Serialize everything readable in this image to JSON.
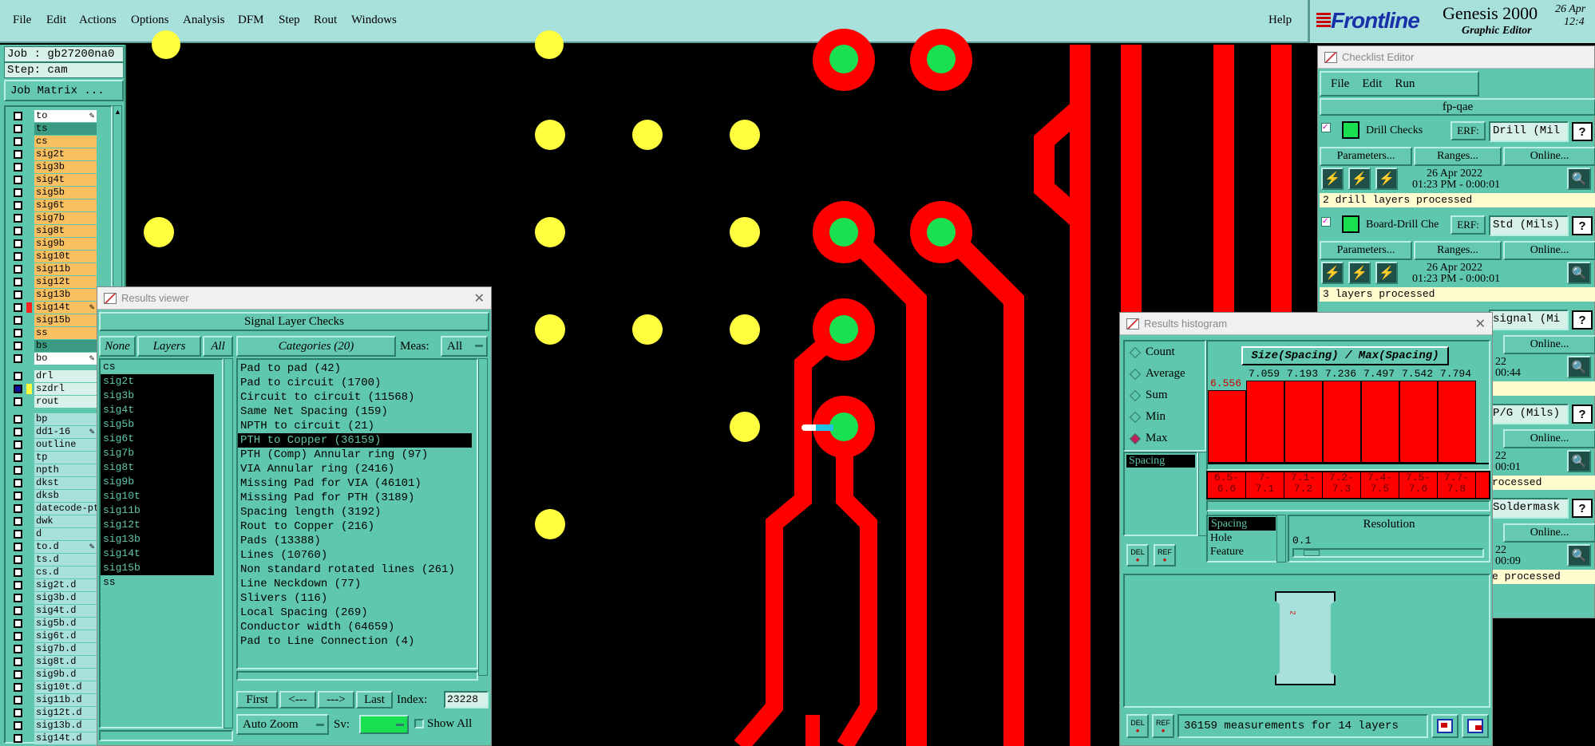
{
  "menubar": {
    "items": [
      "File",
      "Edit",
      "Actions",
      "Options",
      "Analysis",
      "DFM",
      "Step",
      "Rout",
      "Windows"
    ],
    "help": "Help"
  },
  "logo": {
    "brand": "Frontline",
    "product": "Genesis 2000",
    "subtitle": "Graphic Editor",
    "date": "26 Apr",
    "time": "12:4"
  },
  "job": {
    "job_label": "Job : gb27200na0",
    "step_label": "Step: cam",
    "matrix_button": "Job Matrix ..."
  },
  "layers": [
    {
      "name": "to",
      "bg": "#ffffff",
      "mark": true
    },
    {
      "name": "ts",
      "bg": "#3a9b82"
    },
    {
      "name": "cs",
      "bg": "#f8c060"
    },
    {
      "name": "sig2t",
      "bg": "#f8c060"
    },
    {
      "name": "sig3b",
      "bg": "#f8c060"
    },
    {
      "name": "sig4t",
      "bg": "#f8c060"
    },
    {
      "name": "sig5b",
      "bg": "#f8c060"
    },
    {
      "name": "sig6t",
      "bg": "#f8c060"
    },
    {
      "name": "sig7b",
      "bg": "#f8c060"
    },
    {
      "name": "sig8t",
      "bg": "#f8c060"
    },
    {
      "name": "sig9b",
      "bg": "#f8c060"
    },
    {
      "name": "sig10t",
      "bg": "#f8c060"
    },
    {
      "name": "sig11b",
      "bg": "#f8c060"
    },
    {
      "name": "sig12t",
      "bg": "#f8c060"
    },
    {
      "name": "sig13b",
      "bg": "#f8c060"
    },
    {
      "name": "sig14t",
      "bg": "#f8c060",
      "swatch": "#ff2020",
      "mark": true
    },
    {
      "name": "sig15b",
      "bg": "#f8c060"
    },
    {
      "name": "ss",
      "bg": "#f8c060"
    },
    {
      "name": "bs",
      "bg": "#3a9b82"
    },
    {
      "name": "bo",
      "bg": "#ffffff",
      "mark": true
    },
    {
      "name": "drl",
      "bg": "#d8f0ea",
      "gap": true
    },
    {
      "name": "szdrl",
      "bg": "#d8f0ea",
      "swatch": "#ffff40",
      "cbfill": "#1010a0"
    },
    {
      "name": "rout",
      "bg": "#d8f0ea"
    },
    {
      "name": "bp",
      "bg": "#a8e0dc",
      "gap": true
    },
    {
      "name": "dd1-16",
      "bg": "#a8e0dc",
      "mark": true
    },
    {
      "name": "outline",
      "bg": "#a8e0dc"
    },
    {
      "name": "tp",
      "bg": "#a8e0dc"
    },
    {
      "name": "npth",
      "bg": "#a8e0dc"
    },
    {
      "name": "dkst",
      "bg": "#a8e0dc"
    },
    {
      "name": "dksb",
      "bg": "#a8e0dc"
    },
    {
      "name": "datecode-pt",
      "bg": "#a8e0dc"
    },
    {
      "name": "dwk",
      "bg": "#a8e0dc"
    },
    {
      "name": "d",
      "bg": "#a8e0dc"
    },
    {
      "name": "to.d",
      "bg": "#a8e0dc",
      "mark": true
    },
    {
      "name": "ts.d",
      "bg": "#a8e0dc"
    },
    {
      "name": "cs.d",
      "bg": "#a8e0dc"
    },
    {
      "name": "sig2t.d",
      "bg": "#a8e0dc"
    },
    {
      "name": "sig3b.d",
      "bg": "#a8e0dc"
    },
    {
      "name": "sig4t.d",
      "bg": "#a8e0dc"
    },
    {
      "name": "sig5b.d",
      "bg": "#a8e0dc"
    },
    {
      "name": "sig6t.d",
      "bg": "#a8e0dc"
    },
    {
      "name": "sig7b.d",
      "bg": "#a8e0dc"
    },
    {
      "name": "sig8t.d",
      "bg": "#a8e0dc"
    },
    {
      "name": "sig9b.d",
      "bg": "#a8e0dc"
    },
    {
      "name": "sig10t.d",
      "bg": "#a8e0dc"
    },
    {
      "name": "sig11b.d",
      "bg": "#a8e0dc"
    },
    {
      "name": "sig12t.d",
      "bg": "#a8e0dc"
    },
    {
      "name": "sig13b.d",
      "bg": "#a8e0dc"
    },
    {
      "name": "sig14t.d",
      "bg": "#a8e0dc"
    }
  ],
  "results_viewer": {
    "title": "Results viewer",
    "header": "Signal Layer Checks",
    "none_btn": "None",
    "layers_btn": "Layers",
    "all_btn": "All",
    "layer_list": [
      "cs",
      "sig2t",
      "sig3b",
      "sig4t",
      "sig5b",
      "sig6t",
      "sig7b",
      "sig8t",
      "sig9b",
      "sig10t",
      "sig11b",
      "sig12t",
      "sig13b",
      "sig14t",
      "sig15b",
      "ss"
    ],
    "categories_btn": "Categories (20)",
    "meas_label": "Meas:",
    "meas_value": "All",
    "categories": [
      "Pad to pad (42)",
      "Pad to circuit (1700)",
      "Circuit to circuit (11568)",
      "Same Net Spacing (159)",
      "NPTH to circuit (21)",
      "PTH to Copper (36159)",
      "PTH (Comp) Annular ring (97)",
      "VIA Annular ring (2416)",
      "Missing Pad for VIA (46101)",
      "Missing Pad for PTH (3189)",
      "Spacing length (3192)",
      "Rout to Copper (216)",
      "Pads (13388)",
      "Lines (10760)",
      "Non standard rotated lines (261)",
      "Line Neckdown (77)",
      "Slivers (116)",
      "Local Spacing (269)",
      "Conductor width (64659)",
      "Pad to Line Connection (4)"
    ],
    "first_btn": "First",
    "prev_btn": "<---",
    "next_btn": "--->",
    "last_btn": "Last",
    "index_label": "Index:",
    "index_value": "23228",
    "zoom_value": "Auto Zoom",
    "sv_label": "Sv:",
    "show_all_label": "Show All"
  },
  "checklist": {
    "title": "Checklist Editor",
    "menu": [
      "File",
      "Edit",
      "Run"
    ],
    "name": "fp-qae",
    "checks": [
      {
        "name": "Drill Checks",
        "erf_label": "ERF:",
        "erf_value": "Drill (Mil",
        "params": "Parameters...",
        "ranges": "Ranges...",
        "online": "Online...",
        "date": "26 Apr 2022",
        "time": "01:23 PM - 0:00:01",
        "status": "2 drill layers processed"
      },
      {
        "name": "Board-Drill Che",
        "erf_label": "ERF:",
        "erf_value": "Std (Mils)",
        "params": "Parameters...",
        "ranges": "Ranges...",
        "online": "Online...",
        "date": "26 Apr 2022",
        "time": "01:23 PM - 0:00:01",
        "status": "3 layers processed"
      }
    ],
    "partial": [
      {
        "erf": "signal (Mi",
        "online": "Online...",
        "date": "22",
        "time": "00:44",
        "status": ""
      },
      {
        "erf": "P/G (Mils)",
        "online": "Online...",
        "date": "22",
        "time": "00:01",
        "status": "rocessed"
      },
      {
        "erf": "Soldermask",
        "online": "Online...",
        "date": "22",
        "time": "00:09",
        "status": "e processed"
      }
    ],
    "q": "?"
  },
  "histogram": {
    "title": "Results histogram",
    "modes": [
      {
        "label": "Count",
        "on": false
      },
      {
        "label": "Average",
        "on": false
      },
      {
        "label": "Sum",
        "on": false
      },
      {
        "label": "Min",
        "on": false
      },
      {
        "label": "Max",
        "on": true
      }
    ],
    "list_item": "Spacing",
    "chart_title": "Size(Spacing) / Max(Spacing)",
    "bar_values": [
      "6.556",
      "7.059",
      "7.193",
      "7.236",
      "7.497",
      "7.542",
      "7.794"
    ],
    "bar_levels": [
      0.76,
      0.86,
      0.86,
      0.86,
      0.86,
      0.86,
      0.86
    ],
    "bins": [
      [
        "6.5-",
        "6.6"
      ],
      [
        "7-",
        "7.1"
      ],
      [
        "7.1-",
        "7.2"
      ],
      [
        "7.2-",
        "7.3"
      ],
      [
        "7.4-",
        "7.5"
      ],
      [
        "7.5-",
        "7.6"
      ],
      [
        "7.7-",
        "7.8"
      ]
    ],
    "options": [
      "Spacing",
      "Hole",
      "Feature"
    ],
    "resolution_label": "Resolution",
    "resolution_value": "0.1",
    "preview_letter": "2",
    "del": "DEL",
    "ref": "REF",
    "footer": "36159 measurements for 14 layers"
  }
}
